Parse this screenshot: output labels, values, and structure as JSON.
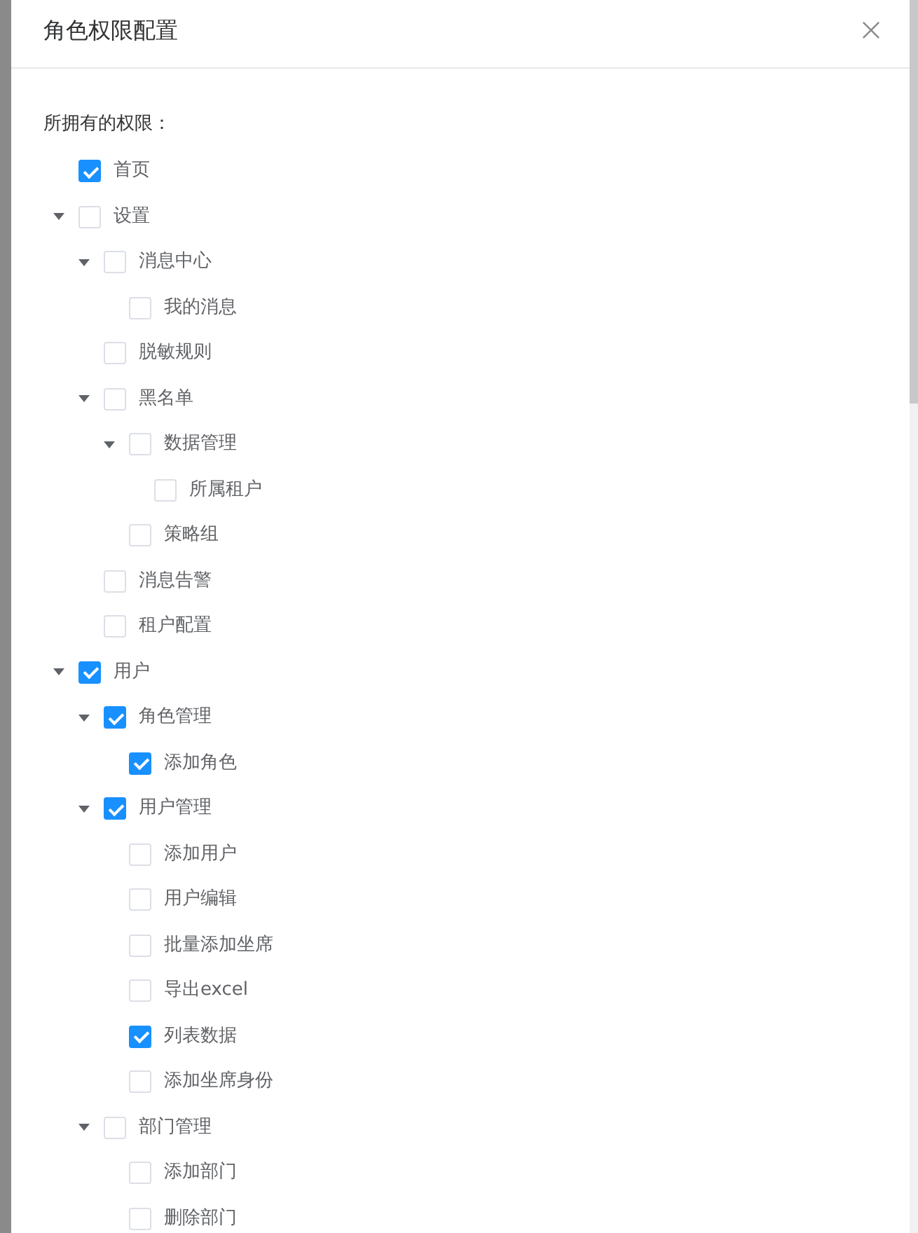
{
  "dialog": {
    "title": "角色权限配置"
  },
  "permissions": {
    "label": "所拥有的权限：",
    "tree": [
      {
        "label": "首页",
        "checked": true
      },
      {
        "label": "设置",
        "checked": false,
        "expanded": true,
        "children": [
          {
            "label": "消息中心",
            "checked": false,
            "expanded": true,
            "children": [
              {
                "label": "我的消息",
                "checked": false
              }
            ]
          },
          {
            "label": "脱敏规则",
            "checked": false
          },
          {
            "label": "黑名单",
            "checked": false,
            "expanded": true,
            "children": [
              {
                "label": "数据管理",
                "checked": false,
                "expanded": true,
                "children": [
                  {
                    "label": "所属租户",
                    "checked": false
                  }
                ]
              },
              {
                "label": "策略组",
                "checked": false
              }
            ]
          },
          {
            "label": "消息告警",
            "checked": false
          },
          {
            "label": "租户配置",
            "checked": false
          }
        ]
      },
      {
        "label": "用户",
        "checked": true,
        "expanded": true,
        "children": [
          {
            "label": "角色管理",
            "checked": true,
            "expanded": true,
            "children": [
              {
                "label": "添加角色",
                "checked": true
              }
            ]
          },
          {
            "label": "用户管理",
            "checked": true,
            "expanded": true,
            "children": [
              {
                "label": "添加用户",
                "checked": false
              },
              {
                "label": "用户编辑",
                "checked": false
              },
              {
                "label": "批量添加坐席",
                "checked": false
              },
              {
                "label": "导出excel",
                "checked": false
              },
              {
                "label": "列表数据",
                "checked": true
              },
              {
                "label": "添加坐席身份",
                "checked": false
              }
            ]
          },
          {
            "label": "部门管理",
            "checked": false,
            "expanded": true,
            "children": [
              {
                "label": "添加部门",
                "checked": false
              },
              {
                "label": "删除部门",
                "checked": false
              }
            ]
          }
        ]
      }
    ]
  }
}
